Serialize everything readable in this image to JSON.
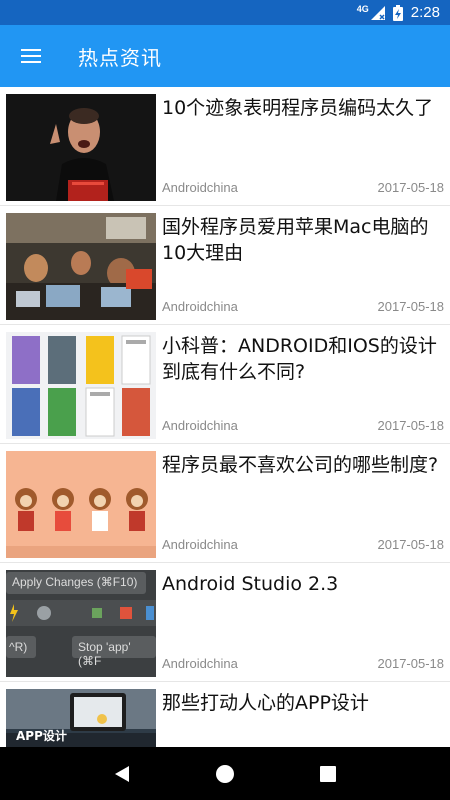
{
  "status_bar": {
    "network": "4G",
    "time": "2:28"
  },
  "app_bar": {
    "title": "热点资讯",
    "menu_icon": "hamburger-menu-icon"
  },
  "news": [
    {
      "title": "10个迹象表明程序员编码太久了",
      "source": "Androidchina",
      "date": "2017-05-18"
    },
    {
      "title": "国外程序员爱用苹果Mac电脑的10大理由",
      "source": "Androidchina",
      "date": "2017-05-18"
    },
    {
      "title": "小科普：ANDROID和IOS的设计到底有什么不同?",
      "source": "Androidchina",
      "date": "2017-05-18"
    },
    {
      "title": "程序员最不喜欢公司的哪些制度?",
      "source": "Androidchina",
      "date": "2017-05-18"
    },
    {
      "title": "Android Studio 2.3",
      "source": "Androidchina",
      "date": "2017-05-18",
      "thumb_text": [
        "Apply Changes (⌘F10)",
        "Stop 'app' (⌘F",
        "^R)"
      ]
    },
    {
      "title": "那些打动人心的APP设计",
      "thumb_caption": "APP设计"
    }
  ],
  "nav_bar": {
    "back_icon": "back-triangle-icon",
    "home_icon": "home-circle-icon",
    "recents_icon": "recents-square-icon"
  },
  "colors": {
    "status_bar": "#1565c0",
    "app_bar": "#2196f3",
    "nav_bar": "#000000"
  }
}
